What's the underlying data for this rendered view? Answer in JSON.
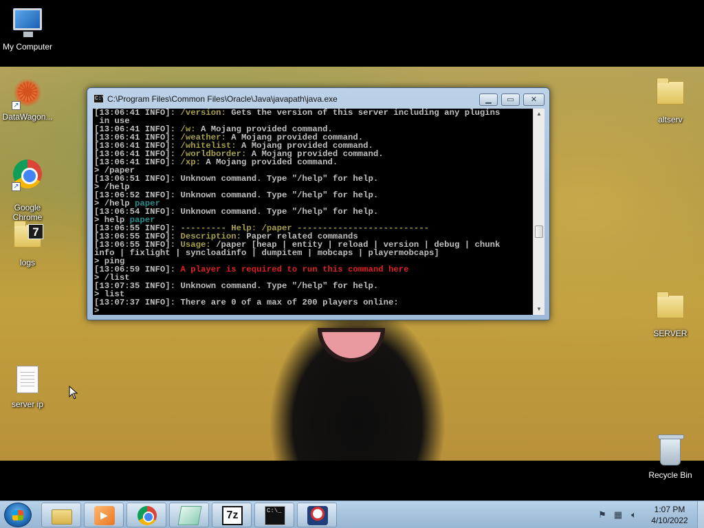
{
  "desktop": {
    "icons": [
      {
        "label": "My Computer",
        "icon": "computer-icon"
      },
      {
        "label": "DataWagon...",
        "icon": "datawagon-icon"
      },
      {
        "label": "Google\nChrome",
        "icon": "chrome-icon"
      },
      {
        "label": "logs",
        "icon": "folder-icon"
      },
      {
        "label": "server ip",
        "icon": "text-document-icon"
      },
      {
        "label": "altserv",
        "icon": "folder-icon"
      },
      {
        "label": "SERVER",
        "icon": "folder-icon"
      },
      {
        "label": "Recycle Bin",
        "icon": "recycle-bin-icon"
      }
    ]
  },
  "console": {
    "title": "C:\\Program Files\\Common Files\\Oracle\\Java\\javapath\\java.exe",
    "title_icon_text": "C:\\",
    "lines": [
      [
        {
          "t": "[13:06:41 INFO]: ",
          "c": "w"
        },
        {
          "t": "/version:",
          "c": "y"
        },
        {
          "t": " Gets the version of this server including any plugins",
          "c": "w"
        }
      ],
      [
        {
          "t": " in use",
          "c": "w"
        }
      ],
      [
        {
          "t": "[13:06:41 INFO]: ",
          "c": "w"
        },
        {
          "t": "/w:",
          "c": "y"
        },
        {
          "t": " A Mojang provided command.",
          "c": "w"
        }
      ],
      [
        {
          "t": "[13:06:41 INFO]: ",
          "c": "w"
        },
        {
          "t": "/weather:",
          "c": "y"
        },
        {
          "t": " A Mojang provided command.",
          "c": "w"
        }
      ],
      [
        {
          "t": "[13:06:41 INFO]: ",
          "c": "w"
        },
        {
          "t": "/whitelist:",
          "c": "y"
        },
        {
          "t": " A Mojang provided command.",
          "c": "w"
        }
      ],
      [
        {
          "t": "[13:06:41 INFO]: ",
          "c": "w"
        },
        {
          "t": "/worldborder:",
          "c": "y"
        },
        {
          "t": " A Mojang provided command.",
          "c": "w"
        }
      ],
      [
        {
          "t": "[13:06:41 INFO]: ",
          "c": "w"
        },
        {
          "t": "/xp:",
          "c": "y"
        },
        {
          "t": " A Mojang provided command.",
          "c": "w"
        }
      ],
      [
        {
          "t": "> /paper",
          "c": "w"
        }
      ],
      [
        {
          "t": "[13:06:51 INFO]: Unknown command. Type \"/help\" for help.",
          "c": "w"
        }
      ],
      [
        {
          "t": "> /help",
          "c": "w"
        }
      ],
      [
        {
          "t": "[13:06:52 INFO]: Unknown command. Type \"/help\" for help.",
          "c": "w"
        }
      ],
      [
        {
          "t": "> /help ",
          "c": "w"
        },
        {
          "t": "paper",
          "c": "c"
        }
      ],
      [
        {
          "t": "[13:06:54 INFO]: Unknown command. Type \"/help\" for help.",
          "c": "w"
        }
      ],
      [
        {
          "t": "> help ",
          "c": "w"
        },
        {
          "t": "paper",
          "c": "c"
        }
      ],
      [
        {
          "t": "[13:06:55 INFO]: ",
          "c": "w"
        },
        {
          "t": "--------- Help: /paper --------------------------",
          "c": "y"
        }
      ],
      [
        {
          "t": "[13:06:55 INFO]: ",
          "c": "w"
        },
        {
          "t": "Description:",
          "c": "y"
        },
        {
          "t": " Paper related commands",
          "c": "w"
        }
      ],
      [
        {
          "t": "[13:06:55 INFO]: ",
          "c": "w"
        },
        {
          "t": "Usage:",
          "c": "y"
        },
        {
          "t": " /paper [heap | entity | reload | version | debug | chunk",
          "c": "w"
        }
      ],
      [
        {
          "t": "info | fixlight | syncloadinfo | dumpitem | mobcaps | playermobcaps]",
          "c": "w"
        }
      ],
      [
        {
          "t": "> ping",
          "c": "w"
        }
      ],
      [
        {
          "t": "[13:06:59 INFO]: ",
          "c": "w"
        },
        {
          "t": "A player is required to run this command here",
          "c": "r"
        }
      ],
      [
        {
          "t": "> /list",
          "c": "w"
        }
      ],
      [
        {
          "t": "[13:07:35 INFO]: Unknown command. Type \"/help\" for help.",
          "c": "w"
        }
      ],
      [
        {
          "t": "> list",
          "c": "w"
        }
      ],
      [
        {
          "t": "[13:07:37 INFO]: There are 0 of a max of 200 players online:",
          "c": "w"
        }
      ],
      [
        {
          "t": ">",
          "c": "w"
        }
      ]
    ]
  },
  "taskbar": {
    "apps": [
      {
        "name": "windows-explorer",
        "icon": "folder-icon"
      },
      {
        "name": "media-player",
        "icon": "media-player-icon"
      },
      {
        "name": "google-chrome",
        "icon": "chrome-icon"
      },
      {
        "name": "sticky-notes",
        "icon": "notes-icon"
      },
      {
        "name": "7-zip",
        "icon": "7zip-icon",
        "text": "7z"
      },
      {
        "name": "command-prompt",
        "icon": "cmd-icon",
        "text": "C:\\_"
      },
      {
        "name": "java",
        "icon": "java-icon"
      }
    ],
    "clock": {
      "time": "1:07 PM",
      "date": "4/10/2022"
    }
  }
}
